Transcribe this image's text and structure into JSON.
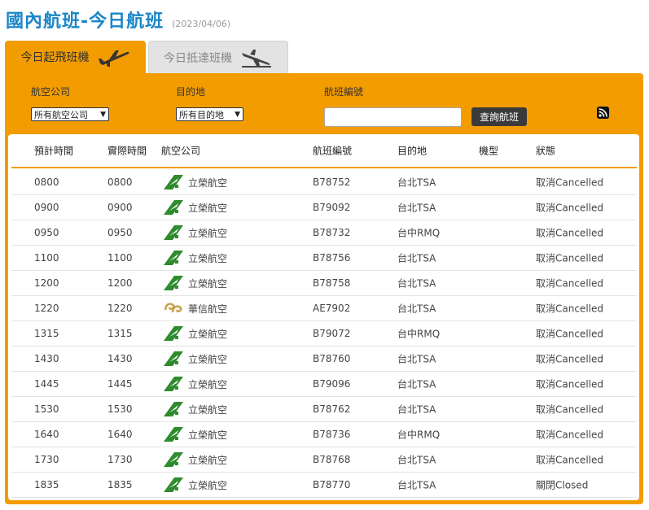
{
  "page": {
    "title": "國內航班-今日航班",
    "date": "(2023/04/06)"
  },
  "tabs": [
    {
      "label": "今日起飛班機",
      "active": true
    },
    {
      "label": "今日抵達班機",
      "active": false
    }
  ],
  "filters": {
    "airline_label": "航空公司",
    "airline_value": "所有航空公司",
    "destination_label": "目的地",
    "destination_value": "所有目的地",
    "flight_label": "航班編號",
    "flight_value": "",
    "search_button": "查詢航班"
  },
  "colors": {
    "accent": "#f29c00",
    "title": "#1a86c8",
    "uni_green": "#2e8b2e",
    "mandarin_gold": "#c9a14a"
  },
  "table": {
    "headers": [
      "預計時間",
      "實際時間",
      "航空公司",
      "航班編號",
      "目的地",
      "機型",
      "狀態"
    ],
    "rows": [
      {
        "sched": "0800",
        "actual": "0800",
        "airline": "立榮航空",
        "logo": "uni-air-logo",
        "flight": "B78752",
        "dest": "台北TSA",
        "type": "",
        "status": "取消Cancelled"
      },
      {
        "sched": "0900",
        "actual": "0900",
        "airline": "立榮航空",
        "logo": "uni-air-logo",
        "flight": "B79092",
        "dest": "台北TSA",
        "type": "",
        "status": "取消Cancelled"
      },
      {
        "sched": "0950",
        "actual": "0950",
        "airline": "立榮航空",
        "logo": "uni-air-logo",
        "flight": "B78732",
        "dest": "台中RMQ",
        "type": "",
        "status": "取消Cancelled"
      },
      {
        "sched": "1100",
        "actual": "1100",
        "airline": "立榮航空",
        "logo": "uni-air-logo",
        "flight": "B78756",
        "dest": "台北TSA",
        "type": "",
        "status": "取消Cancelled"
      },
      {
        "sched": "1200",
        "actual": "1200",
        "airline": "立榮航空",
        "logo": "uni-air-logo",
        "flight": "B78758",
        "dest": "台北TSA",
        "type": "",
        "status": "取消Cancelled"
      },
      {
        "sched": "1220",
        "actual": "1220",
        "airline": "華信航空",
        "logo": "mandarin-airlines-logo",
        "flight": "AE7902",
        "dest": "台北TSA",
        "type": "",
        "status": "取消Cancelled"
      },
      {
        "sched": "1315",
        "actual": "1315",
        "airline": "立榮航空",
        "logo": "uni-air-logo",
        "flight": "B79072",
        "dest": "台中RMQ",
        "type": "",
        "status": "取消Cancelled"
      },
      {
        "sched": "1430",
        "actual": "1430",
        "airline": "立榮航空",
        "logo": "uni-air-logo",
        "flight": "B78760",
        "dest": "台北TSA",
        "type": "",
        "status": "取消Cancelled"
      },
      {
        "sched": "1445",
        "actual": "1445",
        "airline": "立榮航空",
        "logo": "uni-air-logo",
        "flight": "B79096",
        "dest": "台北TSA",
        "type": "",
        "status": "取消Cancelled"
      },
      {
        "sched": "1530",
        "actual": "1530",
        "airline": "立榮航空",
        "logo": "uni-air-logo",
        "flight": "B78762",
        "dest": "台北TSA",
        "type": "",
        "status": "取消Cancelled"
      },
      {
        "sched": "1640",
        "actual": "1640",
        "airline": "立榮航空",
        "logo": "uni-air-logo",
        "flight": "B78736",
        "dest": "台中RMQ",
        "type": "",
        "status": "取消Cancelled"
      },
      {
        "sched": "1730",
        "actual": "1730",
        "airline": "立榮航空",
        "logo": "uni-air-logo",
        "flight": "B78768",
        "dest": "台北TSA",
        "type": "",
        "status": "取消Cancelled"
      },
      {
        "sched": "1835",
        "actual": "1835",
        "airline": "立榮航空",
        "logo": "uni-air-logo",
        "flight": "B78770",
        "dest": "台北TSA",
        "type": "",
        "status": "關閉Closed"
      }
    ]
  }
}
